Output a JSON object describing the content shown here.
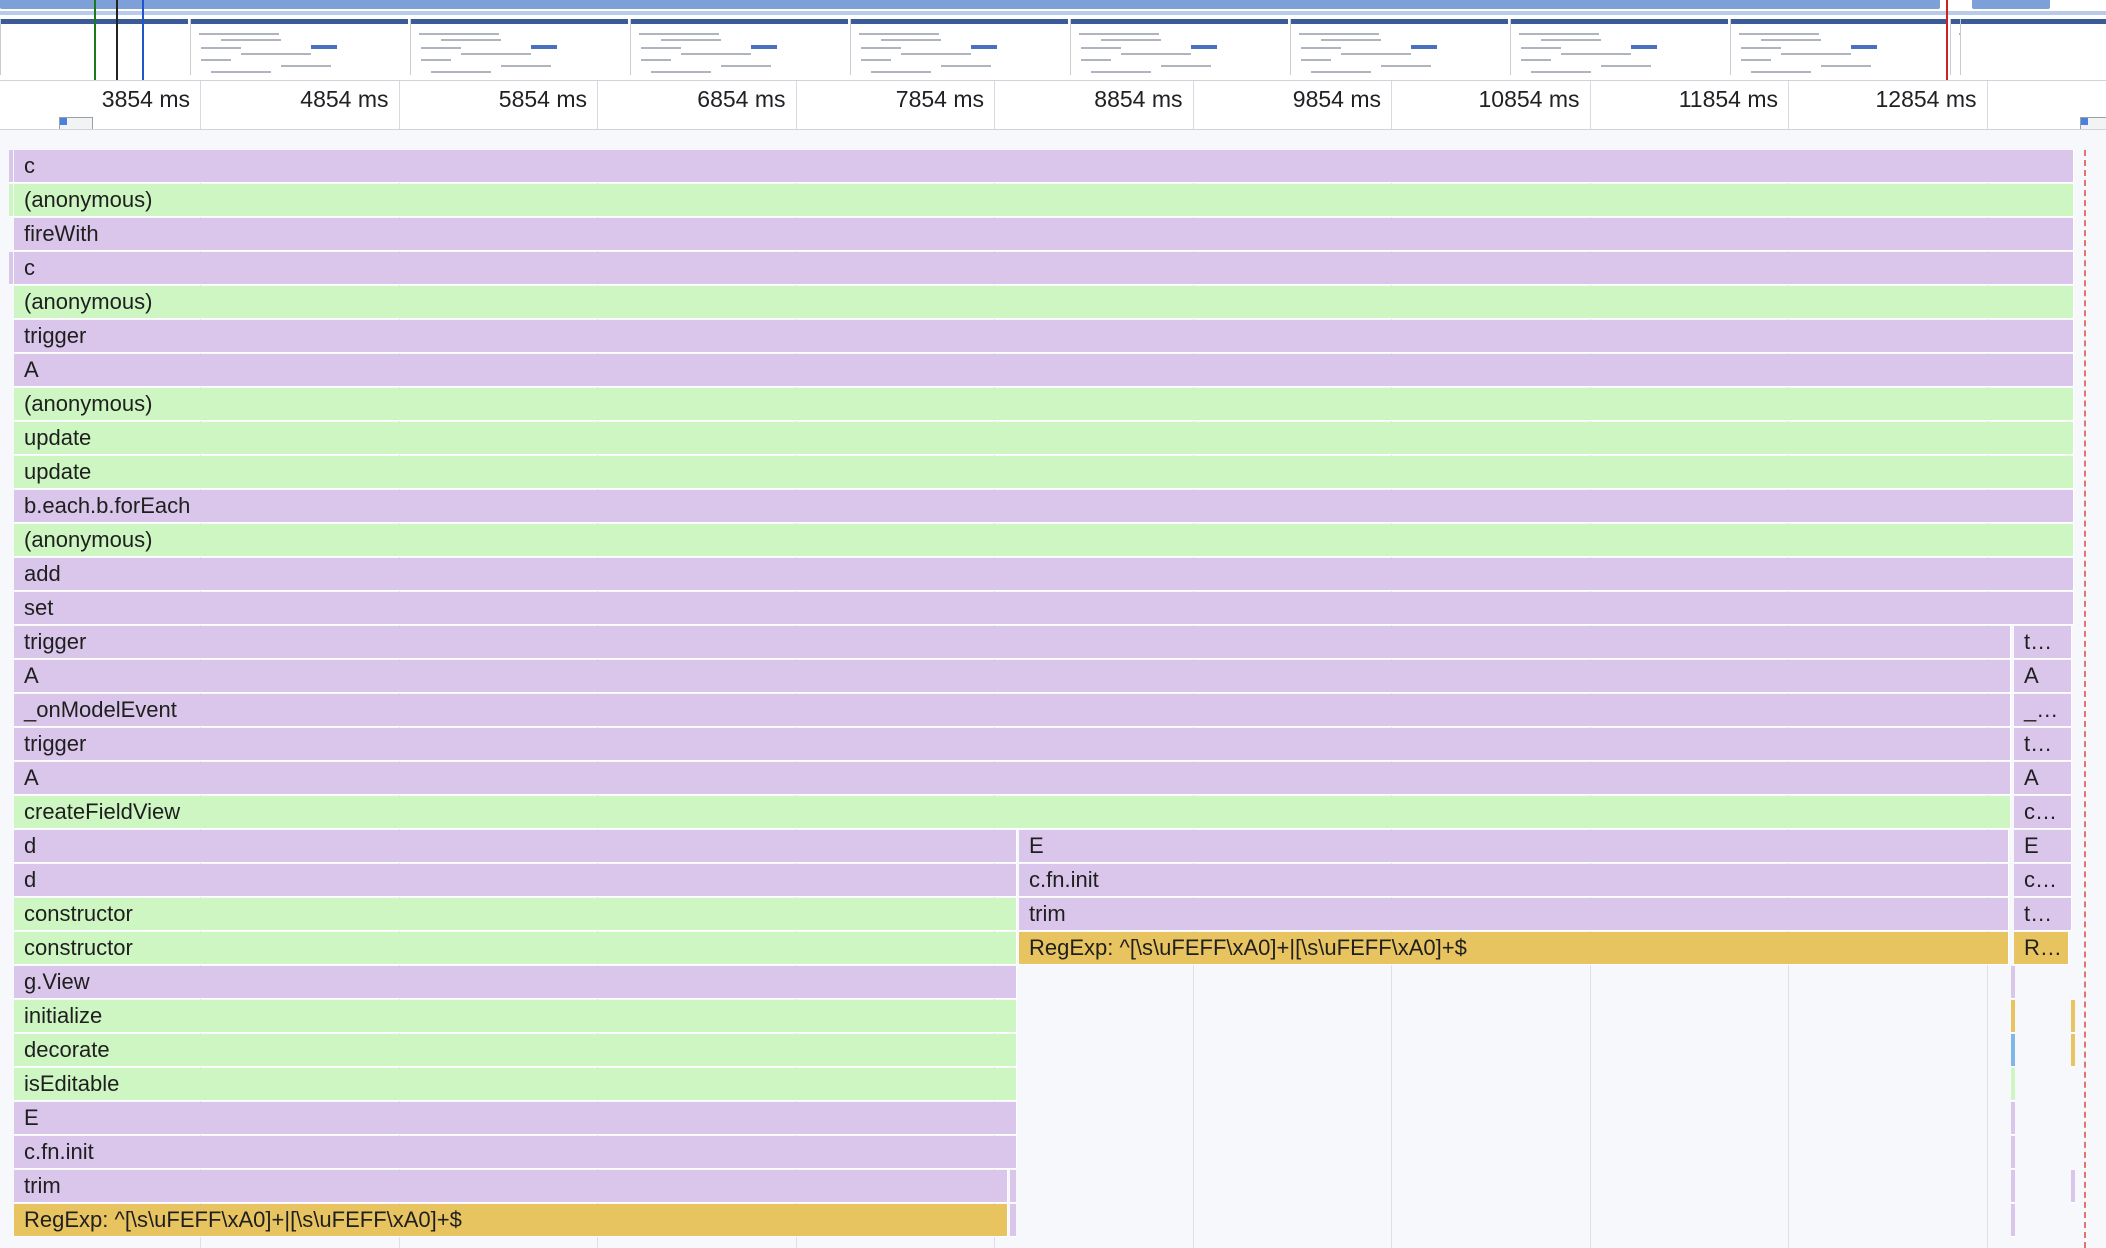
{
  "timeline_ruler": {
    "ticks": [
      "3854 ms",
      "4854 ms",
      "5854 ms",
      "6854 ms",
      "7854 ms",
      "8854 ms",
      "9854 ms",
      "10854 ms",
      "11854 ms",
      "12854 ms",
      "138"
    ]
  },
  "colors": {
    "scripting_purple": "#d9c6ea",
    "scripting_green": "#cdf6c2",
    "regexp_yellow": "#e8c461"
  },
  "flame_chart": {
    "full_rows": [
      "c",
      "(anonymous)",
      "fireWith",
      "c",
      "(anonymous)",
      "trigger",
      "A",
      "(anonymous)",
      "update",
      "update",
      "b.each.b.forEach",
      "(anonymous)",
      "add",
      "set"
    ],
    "mid_rows": [
      {
        "label": "trigger",
        "right": "t…"
      },
      {
        "label": "A",
        "right": "A"
      },
      {
        "label": "_onModelEvent",
        "right": "_…"
      },
      {
        "label": "trigger",
        "right": "t…"
      },
      {
        "label": "A",
        "right": "A"
      },
      {
        "label": "createFieldView",
        "right": "c…"
      }
    ],
    "split_left": [
      "d",
      "d",
      "constructor",
      "constructor"
    ],
    "split_center": [
      "E",
      "c.fn.init",
      "trim",
      "RegExp: ^[\\s\\uFEFF\\xA0]+|[\\s\\uFEFF\\xA0]+$"
    ],
    "split_right": [
      "E",
      "c…",
      "t…",
      "R…"
    ],
    "left_only": [
      "g.View",
      "initialize",
      "decorate",
      "isEditable",
      "E",
      "c.fn.init",
      "trim",
      "RegExp: ^[\\s\\uFEFF\\xA0]+|[\\s\\uFEFF\\xA0]+$"
    ]
  }
}
